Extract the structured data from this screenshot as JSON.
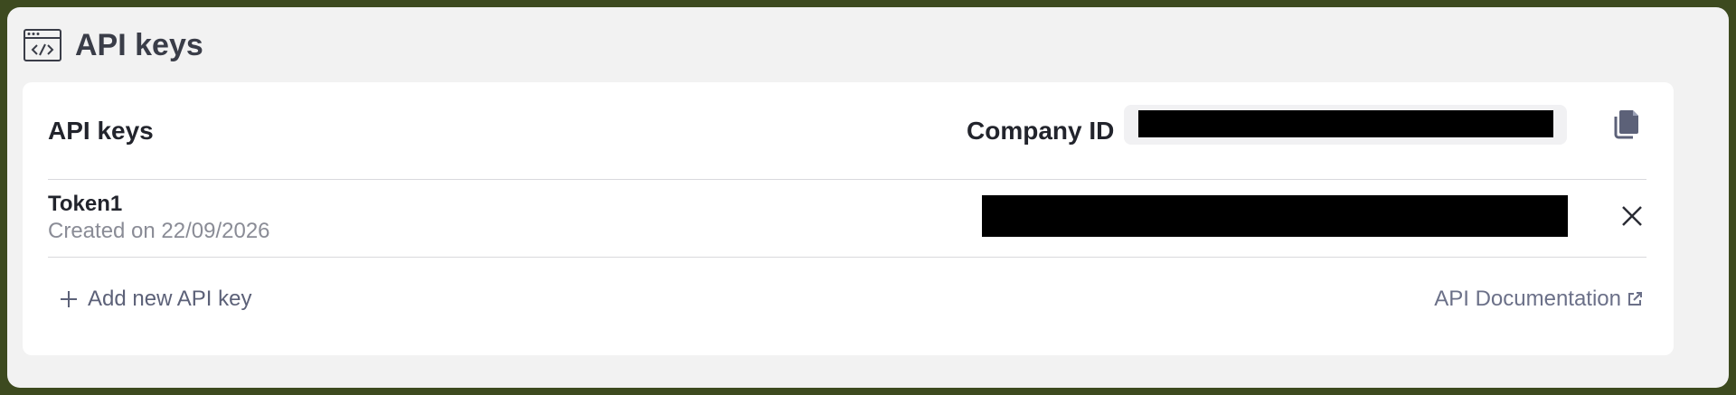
{
  "header": {
    "title": "API keys",
    "icon": "browser-code-icon"
  },
  "card": {
    "title": "API keys",
    "company_id_label": "Company ID",
    "copy_icon": "copy-icon",
    "tokens": [
      {
        "name": "Token1",
        "created": "Created on 22/09/2026",
        "delete_icon": "close-icon"
      }
    ],
    "add_key_label": "Add new API key",
    "add_icon": "plus-icon",
    "doc_link_label": "API Documentation",
    "doc_icon": "external-link-icon"
  },
  "colors": {
    "background": "#f2f2f2",
    "card": "#ffffff",
    "link": "#5c6178",
    "title_dark": "#22242c",
    "muted": "#8a8c96",
    "frame": "#3d4a1f"
  }
}
